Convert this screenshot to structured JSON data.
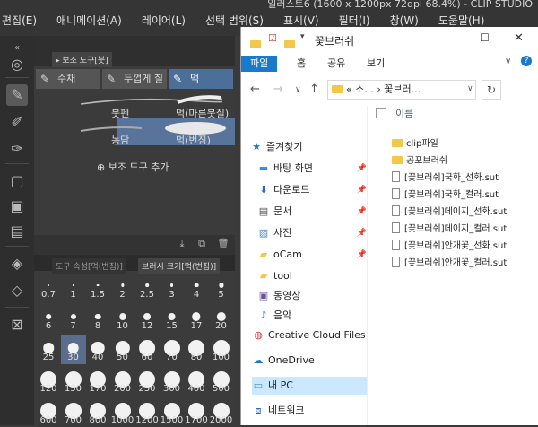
{
  "title": "일러스트6 (1600 x 1200px 72dpi 68.4%) - CLIP STUDIO",
  "menus": [
    "편집(E)",
    "애니메이션(A)",
    "레이어(L)",
    "선택 범위(S)",
    "표시(V)",
    "필터(I)",
    "창(W)",
    "도움말(H)"
  ],
  "panel": {
    "tab_label": "보조 도구[붓]",
    "subtabs": [
      "수채",
      "두껍게 칠",
      "먹"
    ],
    "brushes": [
      {
        "left": "붓펜",
        "right": "먹(마른붓질)"
      },
      {
        "left": "농담",
        "right": "먹(번짐)"
      }
    ],
    "add_tool": "보조 도구 추가"
  },
  "size_panel": {
    "tab1": "도구 속성[먹(번짐)]",
    "tab2": "브러시 크기[먹(번짐)]",
    "values": [
      "0.7",
      "1",
      "1.5",
      "2",
      "2.5",
      "3",
      "4",
      "5",
      "6",
      "7",
      "8",
      "10",
      "12",
      "15",
      "17",
      "20",
      "25",
      "30",
      "40",
      "50",
      "60",
      "70",
      "80",
      "100",
      "120",
      "150",
      "170",
      "200",
      "250",
      "300",
      "400",
      "500",
      "600",
      "700",
      "800",
      "1000",
      "1200",
      "1500",
      "1700",
      "2000"
    ],
    "selected": "30"
  },
  "explorer": {
    "title": "꽃브러쉬",
    "ribbon_tabs": [
      "파일",
      "홈",
      "공유",
      "보기"
    ],
    "address": "«  소...  ›  꽃브러...",
    "column_header": "이름",
    "nav": [
      {
        "label": "즐겨찾기",
        "icon": "star-icon"
      },
      {
        "label": "바탕 화면",
        "icon": "desktop-icon",
        "pin": true
      },
      {
        "label": "다운로드",
        "icon": "download-icon",
        "pin": true
      },
      {
        "label": "문서",
        "icon": "documents-icon",
        "pin": true
      },
      {
        "label": "사진",
        "icon": "pictures-icon",
        "pin": true
      },
      {
        "label": "oCam",
        "icon": "folder-icon",
        "pin": true
      },
      {
        "label": "tool",
        "icon": "folder-icon"
      },
      {
        "label": "동영상",
        "icon": "videos-icon"
      },
      {
        "label": "음악",
        "icon": "music-icon"
      },
      {
        "label": "Creative Cloud Files",
        "icon": "creative-cloud-icon"
      },
      {
        "label": "OneDrive",
        "icon": "onedrive-icon"
      },
      {
        "label": "내 PC",
        "icon": "pc-icon",
        "selected": true
      },
      {
        "label": "네트워크",
        "icon": "network-icon"
      }
    ],
    "files": [
      {
        "name": "clip파일",
        "type": "folder"
      },
      {
        "name": "공포브러쉬",
        "type": "folder"
      },
      {
        "name": "[꽃브러쉬]국화_선화.sut",
        "type": "file"
      },
      {
        "name": "[꽃브러쉬]국화_컬러.sut",
        "type": "file"
      },
      {
        "name": "[꽃브러쉬]데이지_선화.sut",
        "type": "file"
      },
      {
        "name": "[꽃브러쉬]데이지_컬러.sut",
        "type": "file"
      },
      {
        "name": "[꽃브러쉬]안개꽃_선화.sut",
        "type": "file"
      },
      {
        "name": "[꽃브러쉬]안개꽃_컬러.sut",
        "type": "file"
      }
    ]
  }
}
